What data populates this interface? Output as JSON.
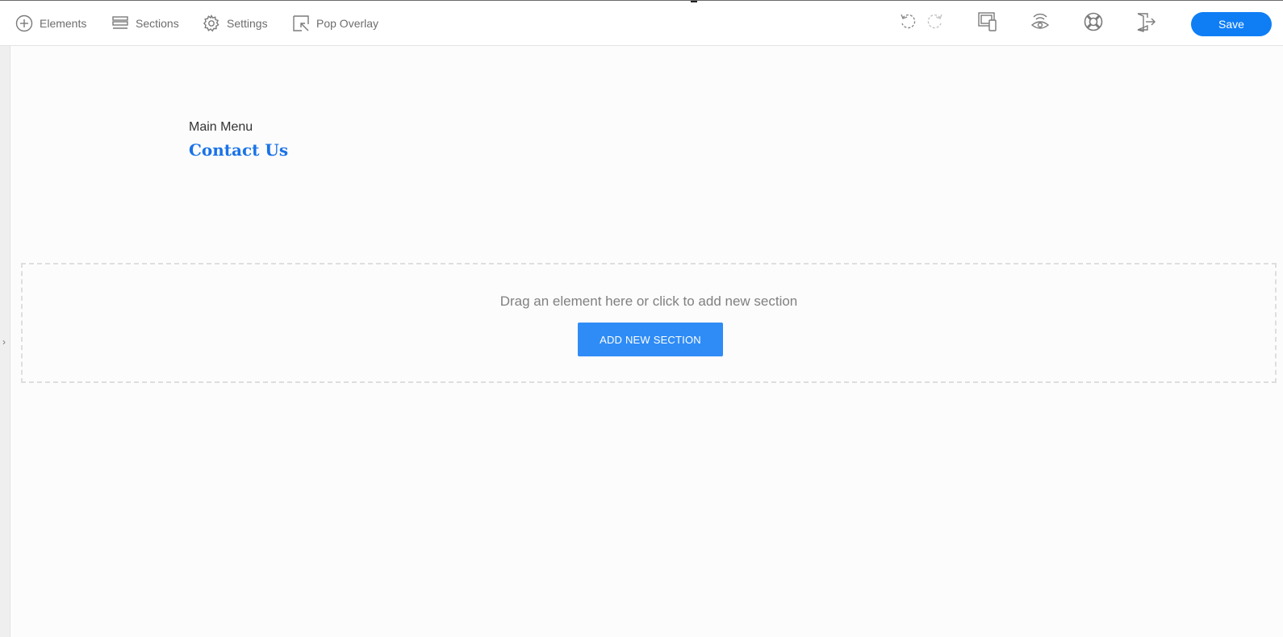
{
  "toolbar": {
    "elements_label": "Elements",
    "sections_label": "Sections",
    "settings_label": "Settings",
    "pop_overlay_label": "Pop Overlay",
    "save_label": "Save",
    "icons": [
      "plus-circle-icon",
      "sections-icon",
      "gear-icon",
      "pop-overlay-icon",
      "undo-icon",
      "redo-icon",
      "responsive-icon",
      "preview-icon",
      "help-icon",
      "exit-icon"
    ]
  },
  "canvas": {
    "menu_label": "Main Menu",
    "menu_link": "Contact Us",
    "dropzone_text": "Drag an element here or click to add new section",
    "add_section_label": "ADD NEW SECTION"
  },
  "colors": {
    "accent": "#0f7ef5",
    "link": "#1a73e8",
    "add_button": "#2f8cf6",
    "icon_gray": "#7a7a7a"
  }
}
